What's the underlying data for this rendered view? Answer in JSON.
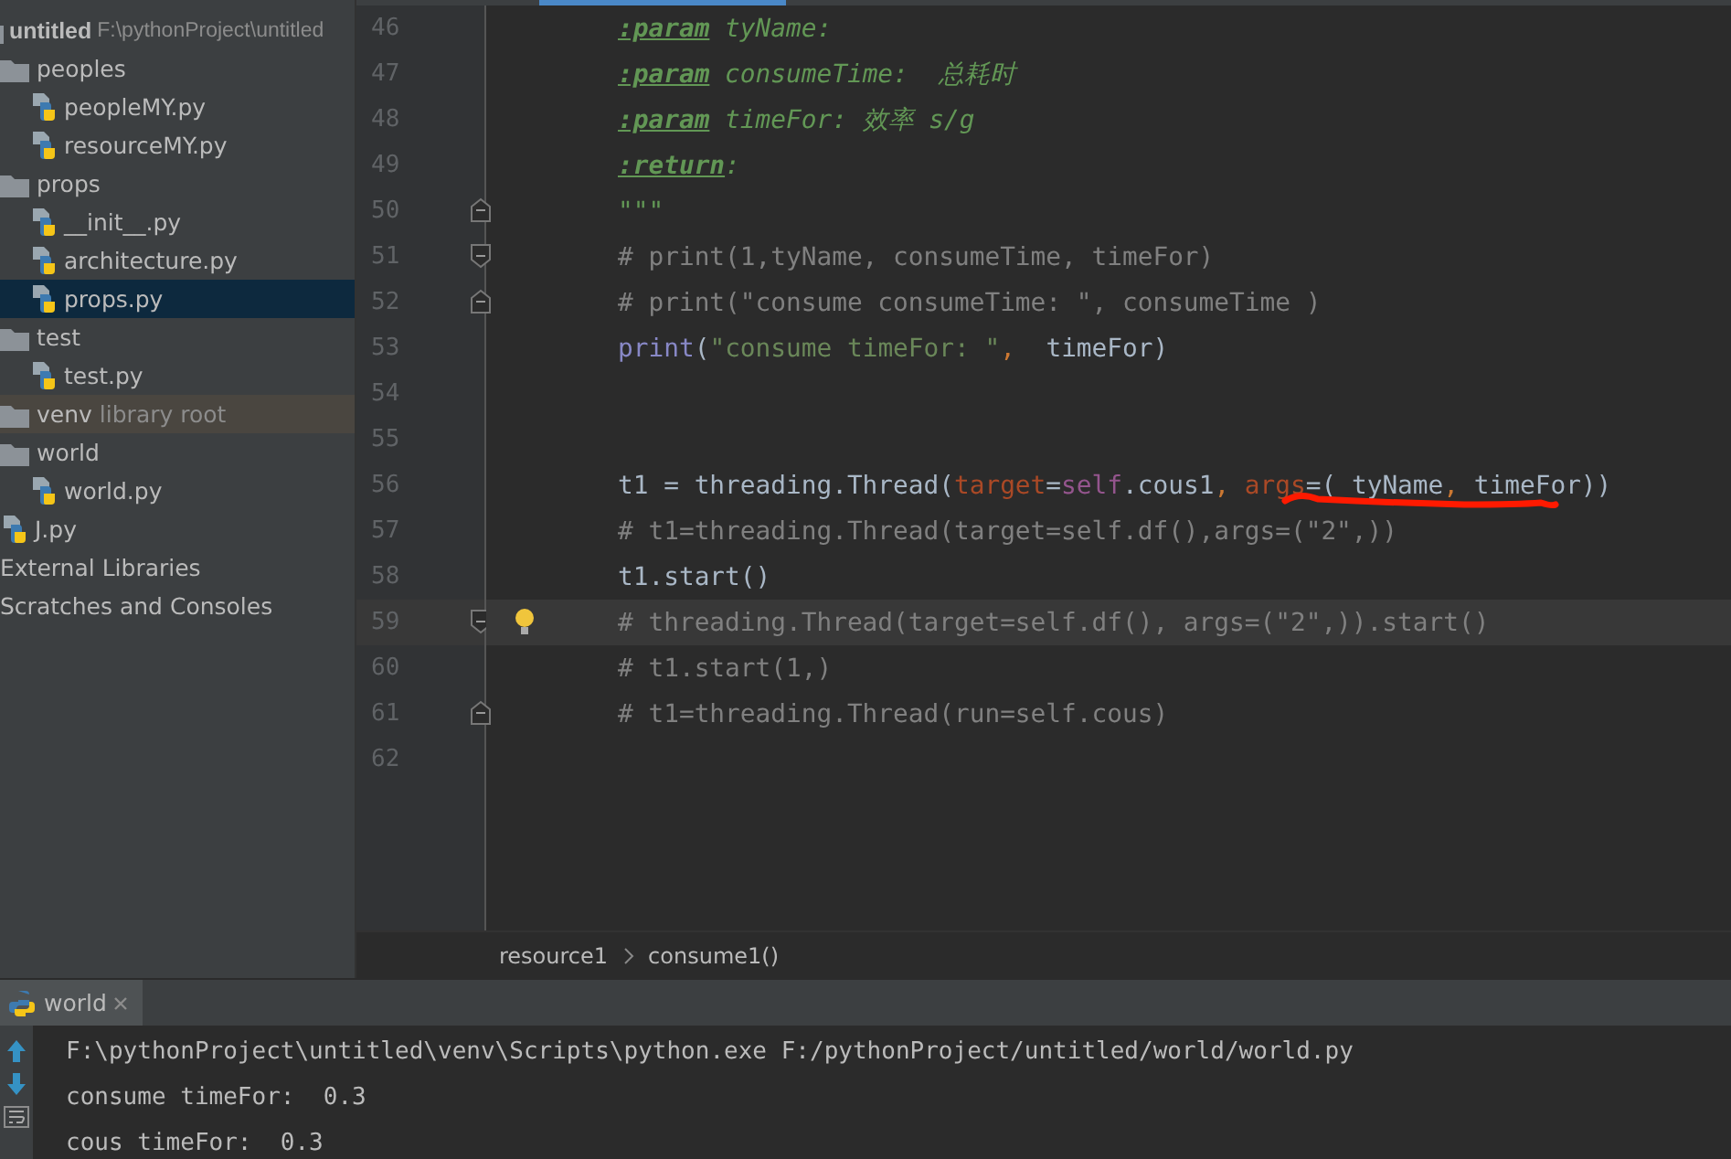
{
  "project_tree": [
    {
      "label": "untitled",
      "note": "F:\\pythonProject\\untitled",
      "kind": "root",
      "selected": false,
      "children": [
        {
          "label": "peoples",
          "kind": "folder",
          "selected": false,
          "children": [
            {
              "label": "peopleMY.py",
              "kind": "pyfile",
              "selected": false
            },
            {
              "label": "resourceMY.py",
              "kind": "pyfile",
              "selected": false
            }
          ]
        },
        {
          "label": "props",
          "kind": "folder",
          "selected": false,
          "children": [
            {
              "label": "__init__.py",
              "kind": "pyfile",
              "selected": false
            },
            {
              "label": "architecture.py",
              "kind": "pyfile",
              "selected": false
            },
            {
              "label": "props.py",
              "kind": "pyfile",
              "selected": true
            }
          ]
        },
        {
          "label": "test",
          "kind": "folder",
          "selected": false,
          "children": [
            {
              "label": "test.py",
              "kind": "pyfile",
              "selected": false
            }
          ]
        },
        {
          "label": "venv",
          "note": "library root",
          "kind": "library",
          "selected": false
        },
        {
          "label": "world",
          "kind": "folder",
          "selected": false,
          "children": [
            {
              "label": "world.py",
              "kind": "pyfile",
              "selected": false
            }
          ]
        },
        {
          "label": "J.py",
          "kind": "pyfile",
          "selected": false
        }
      ]
    },
    {
      "label": "External Libraries",
      "kind": "plain",
      "selected": false
    },
    {
      "label": "Scratches and Consoles",
      "kind": "plain",
      "selected": false
    }
  ],
  "editor": {
    "lines": [
      {
        "number": "46",
        "current": false,
        "fold_start": false,
        "fold_end": false,
        "bulb": false,
        "annotated": false,
        "segments": [
          {
            "kind": "doctag",
            "text": ":param"
          },
          {
            "kind": "doc",
            "text": " tyName:"
          }
        ]
      },
      {
        "number": "47",
        "current": false,
        "fold_start": false,
        "fold_end": false,
        "bulb": false,
        "annotated": false,
        "segments": [
          {
            "kind": "doctag",
            "text": ":param"
          },
          {
            "kind": "doc",
            "text": " consumeTime:  总耗时"
          }
        ]
      },
      {
        "number": "48",
        "current": false,
        "fold_start": false,
        "fold_end": false,
        "bulb": false,
        "annotated": false,
        "segments": [
          {
            "kind": "doctag",
            "text": ":param"
          },
          {
            "kind": "doc",
            "text": " timeFor: 效率 s/g"
          }
        ]
      },
      {
        "number": "49",
        "current": false,
        "fold_start": false,
        "fold_end": false,
        "bulb": false,
        "annotated": false,
        "segments": [
          {
            "kind": "doctag",
            "text": ":return"
          },
          {
            "kind": "doc",
            "text": ":"
          }
        ]
      },
      {
        "number": "50",
        "current": false,
        "fold_start": false,
        "fold_end": true,
        "bulb": false,
        "annotated": false,
        "segments": [
          {
            "kind": "doc",
            "text": "\"\"\""
          }
        ]
      },
      {
        "number": "51",
        "current": false,
        "fold_start": true,
        "fold_end": false,
        "bulb": false,
        "annotated": false,
        "segments": [
          {
            "kind": "comment",
            "text": "# print(1,tyName, consumeTime, timeFor)"
          }
        ]
      },
      {
        "number": "52",
        "current": false,
        "fold_start": false,
        "fold_end": true,
        "bulb": false,
        "annotated": false,
        "segments": [
          {
            "kind": "comment",
            "text": "# print(\"consume consumeTime: \", consumeTime )"
          }
        ]
      },
      {
        "number": "53",
        "current": false,
        "fold_start": false,
        "fold_end": false,
        "bulb": false,
        "annotated": false,
        "segments": [
          {
            "kind": "builtin",
            "text": "print"
          },
          {
            "kind": "plain",
            "text": "("
          },
          {
            "kind": "string",
            "text": "\"consume timeFor: \""
          },
          {
            "kind": "punct",
            "text": ","
          },
          {
            "kind": "plain",
            "text": "  timeFor)"
          }
        ]
      },
      {
        "number": "54",
        "current": false,
        "fold_start": false,
        "fold_end": false,
        "bulb": false,
        "annotated": false
      },
      {
        "number": "55",
        "current": false,
        "fold_start": false,
        "fold_end": false,
        "bulb": false,
        "annotated": false
      },
      {
        "number": "56",
        "current": false,
        "fold_start": false,
        "fold_end": false,
        "bulb": false,
        "annotated": true,
        "segments": [
          {
            "kind": "plain",
            "text": "t1 = threading.Thread("
          },
          {
            "kind": "param",
            "text": "target"
          },
          {
            "kind": "plain",
            "text": "="
          },
          {
            "kind": "self",
            "text": "self"
          },
          {
            "kind": "plain",
            "text": ".cous1"
          },
          {
            "kind": "punct",
            "text": ", "
          },
          {
            "kind": "param",
            "text": "args"
          },
          {
            "kind": "plain",
            "text": "=( tyName"
          },
          {
            "kind": "punct",
            "text": ", "
          },
          {
            "kind": "plain",
            "text": "timeFor))"
          }
        ]
      },
      {
        "number": "57",
        "current": false,
        "fold_start": false,
        "fold_end": false,
        "bulb": false,
        "annotated": false,
        "segments": [
          {
            "kind": "comment",
            "text": "# t1=threading.Thread(target=self.df(),args=(\"2\",))"
          }
        ]
      },
      {
        "number": "58",
        "current": false,
        "fold_start": false,
        "fold_end": false,
        "bulb": false,
        "annotated": false,
        "segments": [
          {
            "kind": "plain",
            "text": "t1.start()"
          }
        ]
      },
      {
        "number": "59",
        "current": true,
        "fold_start": true,
        "fold_end": false,
        "bulb": true,
        "annotated": false,
        "segments": [
          {
            "kind": "comment",
            "text": "# threading.Thread(target=self.df(), args=(\"2\",)).start()"
          }
        ]
      },
      {
        "number": "60",
        "current": false,
        "fold_start": false,
        "fold_end": false,
        "bulb": false,
        "annotated": false,
        "segments": [
          {
            "kind": "comment",
            "text": "# t1.start(1,)"
          }
        ]
      },
      {
        "number": "61",
        "current": false,
        "fold_start": false,
        "fold_end": true,
        "bulb": false,
        "annotated": false,
        "segments": [
          {
            "kind": "comment",
            "text": "# t1=threading.Thread(run=self.cous)"
          }
        ]
      },
      {
        "number": "62",
        "current": false,
        "fold_start": false,
        "fold_end": false,
        "bulb": false,
        "annotated": false
      }
    ]
  },
  "breadcrumbs": [
    "resource1",
    "consume1()"
  ],
  "run_panel": {
    "tab": {
      "label": "world",
      "selected": true
    },
    "console": [
      "F:\\pythonProject\\untitled\\venv\\Scripts\\python.exe F:/pythonProject/untitled/world/world.py",
      "consume timeFor:  0.3",
      "cous timeFor:  0.3"
    ]
  }
}
